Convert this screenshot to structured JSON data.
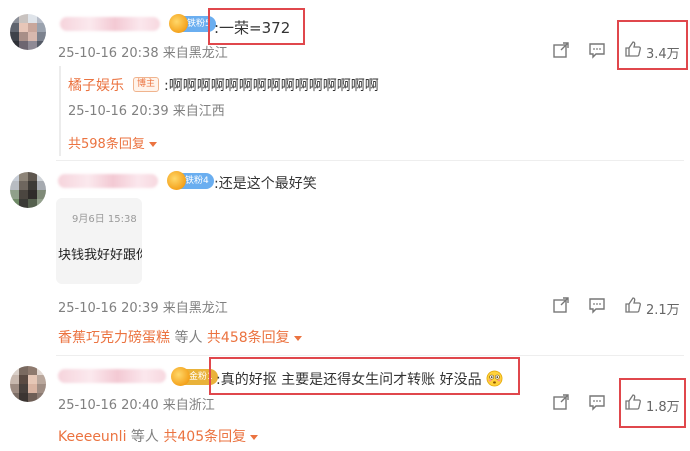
{
  "comments": [
    {
      "badge": "铁粉5",
      "text": ":一荣=372",
      "meta": "25-10-16 20:38 来自黑龙江",
      "likes": "3.4万",
      "reply": {
        "author": "橘子娱乐",
        "tag": "博主",
        "text": ":啊啊啊啊啊啊啊啊啊啊啊啊啊啊啊",
        "meta": "25-10-16 20:39 来自江西",
        "count": "共598条回复"
      }
    },
    {
      "badge": "铁粉4",
      "text": ":还是这个最好笑",
      "image_time": "9月6日 15:38",
      "image_text": "块钱我好好跟你",
      "meta": "25-10-16 20:39 来自黑龙江",
      "likes": "2.1万",
      "replies_summary": {
        "name": "香蕉巧克力磅蛋糕",
        "etc": "等人",
        "count": "共458条回复"
      }
    },
    {
      "badge": "金粉1",
      "text": ":真的好抠 主要是还得女生问才转账 好没品",
      "meta": "25-10-16 20:40 来自浙江",
      "likes": "1.8万",
      "replies_summary": {
        "name": "Keeeeunli",
        "etc": "等人",
        "count": "共405条回复"
      }
    }
  ],
  "icons": {
    "share": "share-icon",
    "comment": "comment-icon",
    "like": "thumbs-up-icon",
    "emoji": "flushed-face-emoji"
  },
  "colors": {
    "highlight": "#e0474c",
    "orange": "#eb7340",
    "meta_gray": "#808080"
  }
}
